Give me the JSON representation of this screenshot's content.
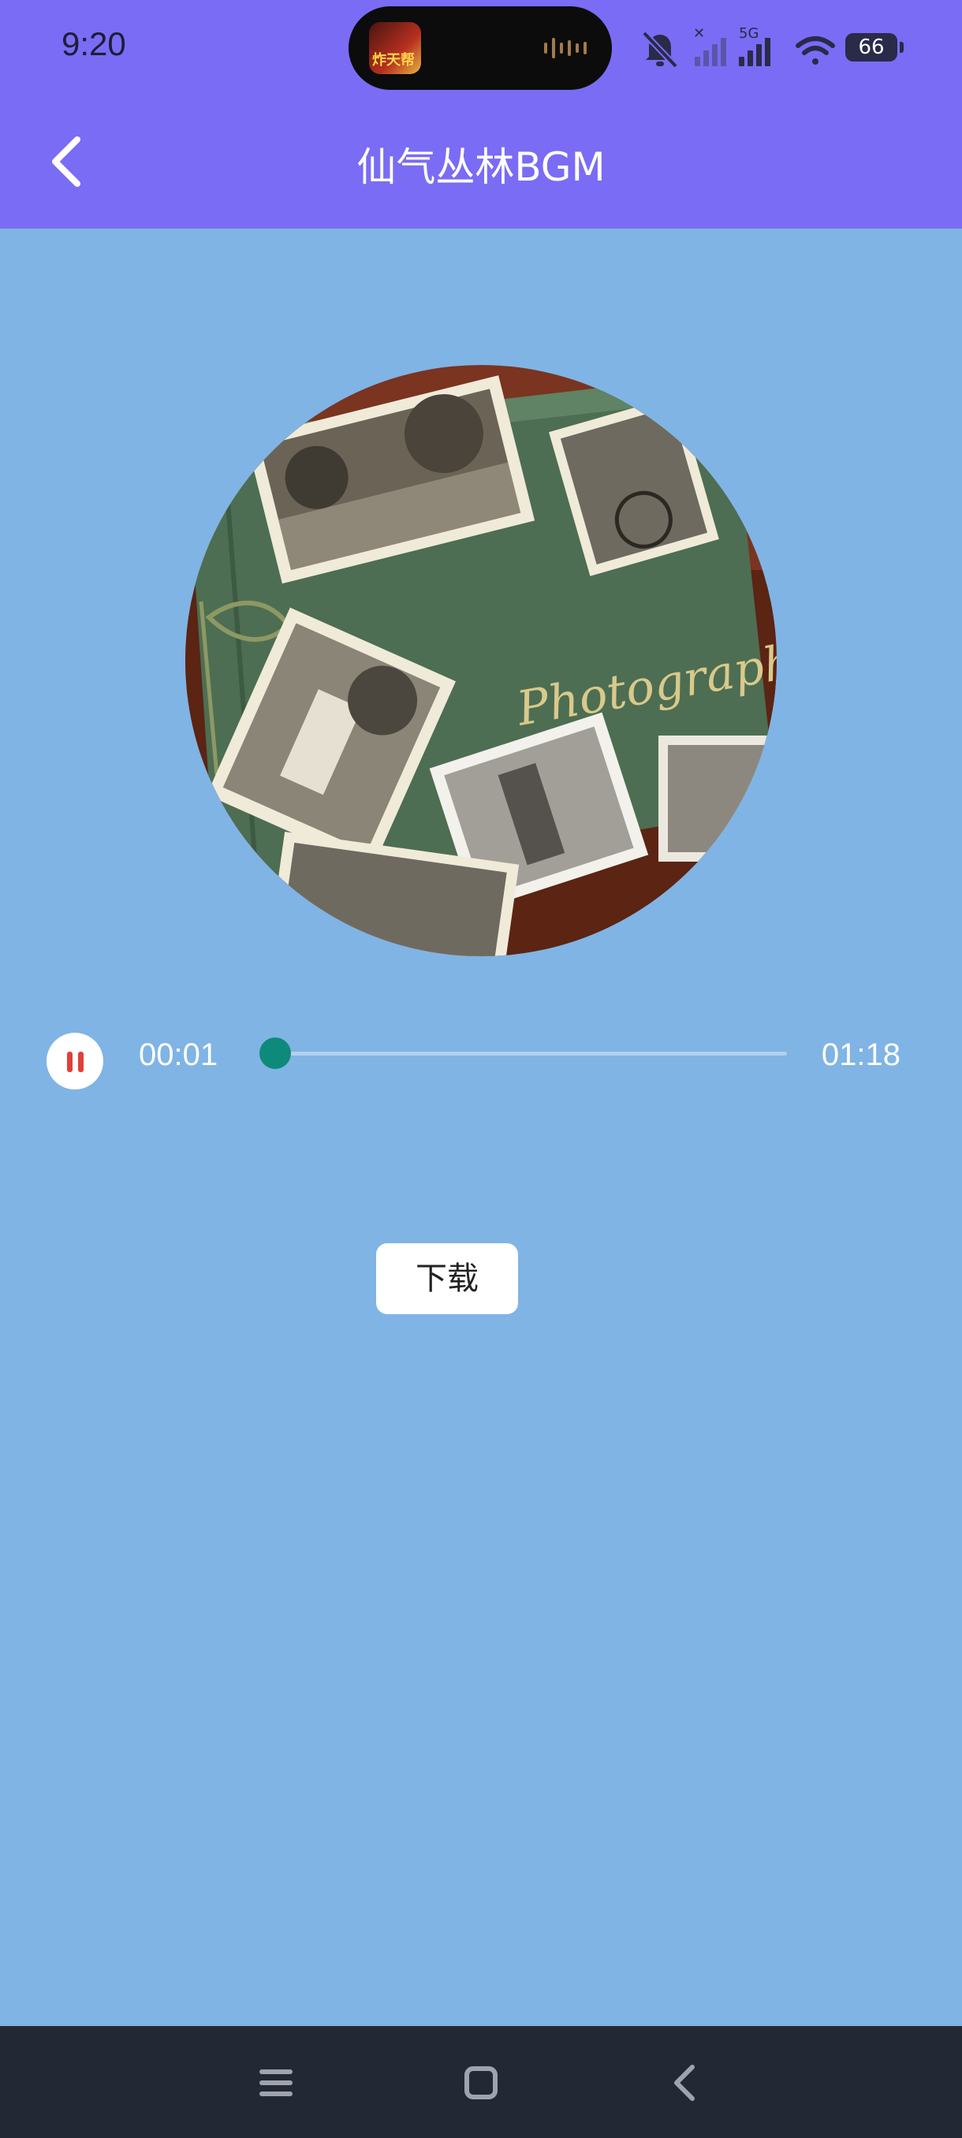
{
  "status_bar": {
    "time": "9:20",
    "now_playing_art_text": "炸天帮",
    "battery_level": "66",
    "icons": [
      "mute-icon",
      "no-signal-icon",
      "signal-5g-icon",
      "wifi-icon",
      "battery-icon"
    ]
  },
  "app_bar": {
    "title": "仙气丛林BGM",
    "back_icon": "chevron-left-icon"
  },
  "cover": {
    "album_text": "Photographs"
  },
  "player": {
    "state": "playing",
    "current_time": "00:01",
    "total_time": "01:18",
    "progress_fraction": 0.013,
    "accent_color": "#0E8A7A",
    "pause_icon_color": "#E0403A"
  },
  "actions": {
    "download_label": "下载"
  },
  "nav_bar": {
    "items": [
      "menu-icon",
      "home-icon",
      "back-icon"
    ]
  },
  "colors": {
    "header": "#7A6CF4",
    "background": "#80B4E4",
    "nav_bar": "#222834"
  }
}
